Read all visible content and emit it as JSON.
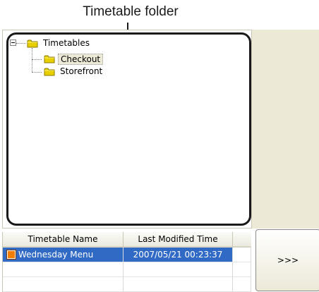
{
  "callout": {
    "label": "Timetable folder"
  },
  "tree": {
    "root": {
      "label": "Timetables",
      "expanded": true,
      "icon": "folder-icon"
    },
    "children": [
      {
        "label": "Checkout",
        "selected": true,
        "icon": "folder-icon"
      },
      {
        "label": "Storefront",
        "selected": false,
        "icon": "folder-icon"
      }
    ]
  },
  "table": {
    "columns": [
      "Timetable Name",
      "Last Modified Time"
    ],
    "rows": [
      {
        "name": "Wednesday Menu",
        "modified": "2007/05/21 00:23:37",
        "selected": true,
        "swatch_color": "#f07c00"
      }
    ]
  },
  "move_button": {
    "label": ">>>"
  },
  "colors": {
    "selection": "#316ac5",
    "panel_background": "#ecead6",
    "tree_selection": "#ecead6"
  }
}
